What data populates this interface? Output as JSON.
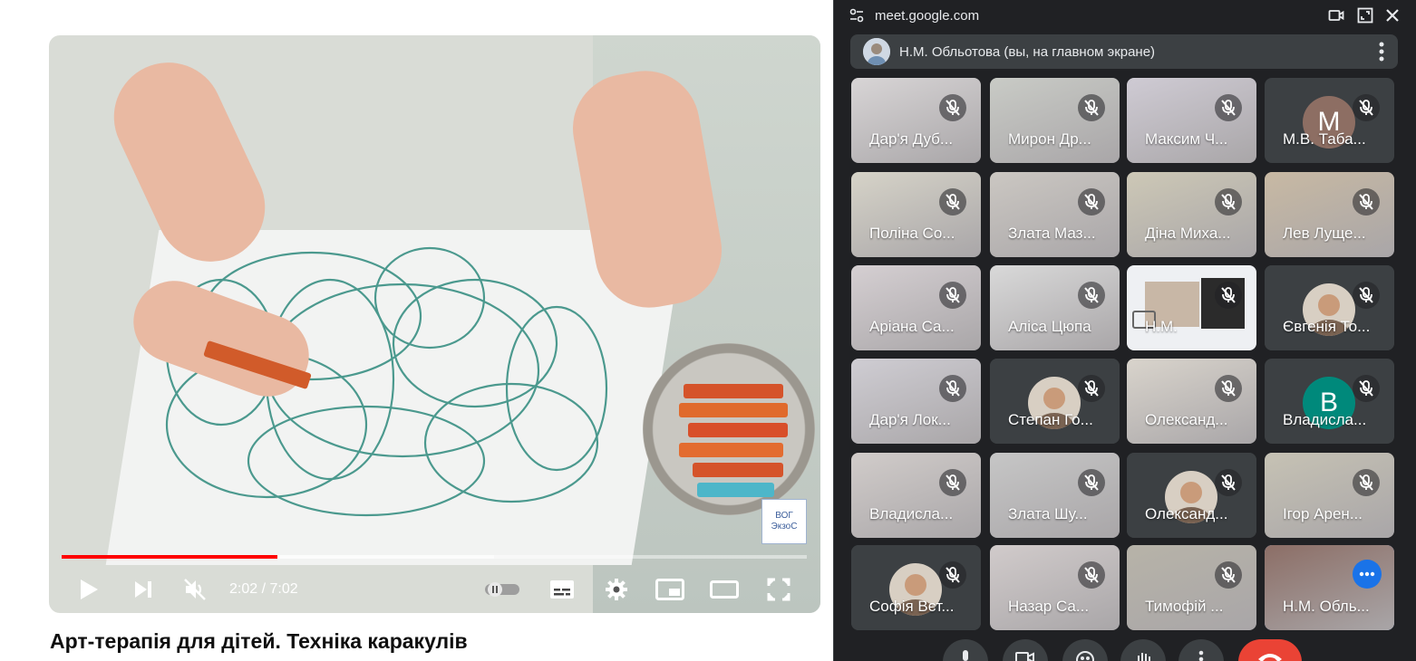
{
  "video": {
    "current_time": "2:02",
    "duration": "7:02",
    "time_display": "2:02 / 7:02",
    "progress_fraction": 0.289,
    "buffered_fraction": 0.58,
    "title": "Арт-терапія для дітей. Техніка каракулів",
    "watermark_text": "ВОГ ЭкзоС",
    "accent_color": "#ff0000"
  },
  "player_controls": {
    "play_icon": "play-icon",
    "next_icon": "next-icon",
    "mute_icon": "volume-muted-icon",
    "autoplay_icon": "autoplay-toggle-icon",
    "subtitles_icon": "subtitles-icon",
    "settings_icon": "gear-icon",
    "miniplayer_icon": "miniplayer-icon",
    "theater_icon": "theater-mode-icon",
    "fullscreen_icon": "fullscreen-icon"
  },
  "meet": {
    "url": "meet.google.com",
    "presenter_label": "Н.М. Обльотова (вы, на главном экране)",
    "accent_color": "#8ab4f8",
    "end_call_color": "#ea4335",
    "participants": [
      {
        "name": "Дар'я Дуб...",
        "kind": "video",
        "bg": "#d8d5d6"
      },
      {
        "name": "Мирон Др...",
        "kind": "video",
        "bg": "#c9cbc6"
      },
      {
        "name": "Максим Ч...",
        "kind": "video",
        "bg": "#cfcbd4"
      },
      {
        "name": "М.В. Таба...",
        "kind": "letter",
        "letter": "M",
        "avatar_color": "#8d6e63"
      },
      {
        "name": "Поліна Со...",
        "kind": "video",
        "bg": "#d6d3c8"
      },
      {
        "name": "Злата Маз...",
        "kind": "video",
        "bg": "#cbc7c2"
      },
      {
        "name": "Діна Миха...",
        "kind": "video",
        "bg": "#cdc8b6"
      },
      {
        "name": "Лев Луще...",
        "kind": "video",
        "bg": "#c8b9a3"
      },
      {
        "name": "Аріана Са...",
        "kind": "video",
        "bg": "#d5cfd2"
      },
      {
        "name": "Аліса Цюпа",
        "kind": "video",
        "bg": "#d9d9d9"
      },
      {
        "name": "Н.М.",
        "kind": "screen",
        "bg": "#eef0f3"
      },
      {
        "name": "Євгенія То...",
        "kind": "photo",
        "bg": "#3c4043"
      },
      {
        "name": "Дар'я Лок...",
        "kind": "video",
        "bg": "#cfcdd3"
      },
      {
        "name": "Степан Го...",
        "kind": "photo",
        "bg": "#3c4043"
      },
      {
        "name": "Олександ...",
        "kind": "video",
        "bg": "#d9d4cc"
      },
      {
        "name": "Владисла...",
        "kind": "letter",
        "letter": "B",
        "avatar_color": "#00897b"
      },
      {
        "name": "Владисла...",
        "kind": "video",
        "bg": "#d1ccca"
      },
      {
        "name": "Злата Шу...",
        "kind": "video",
        "bg": "#c6c6c6"
      },
      {
        "name": "Олександ...",
        "kind": "photo",
        "bg": "#3c4043"
      },
      {
        "name": "Ігор Арен...",
        "kind": "video",
        "bg": "#c6c2b4"
      },
      {
        "name": "Софія Вєт...",
        "kind": "photo",
        "bg": "#3c4043"
      },
      {
        "name": "Назар Са...",
        "kind": "video",
        "bg": "#d1cbcb"
      },
      {
        "name": "Тимофій ...",
        "kind": "video",
        "bg": "#b7b3a8"
      },
      {
        "name": "Н.М. Обль...",
        "kind": "video",
        "bg": "#8c6e66",
        "active": true
      }
    ]
  }
}
